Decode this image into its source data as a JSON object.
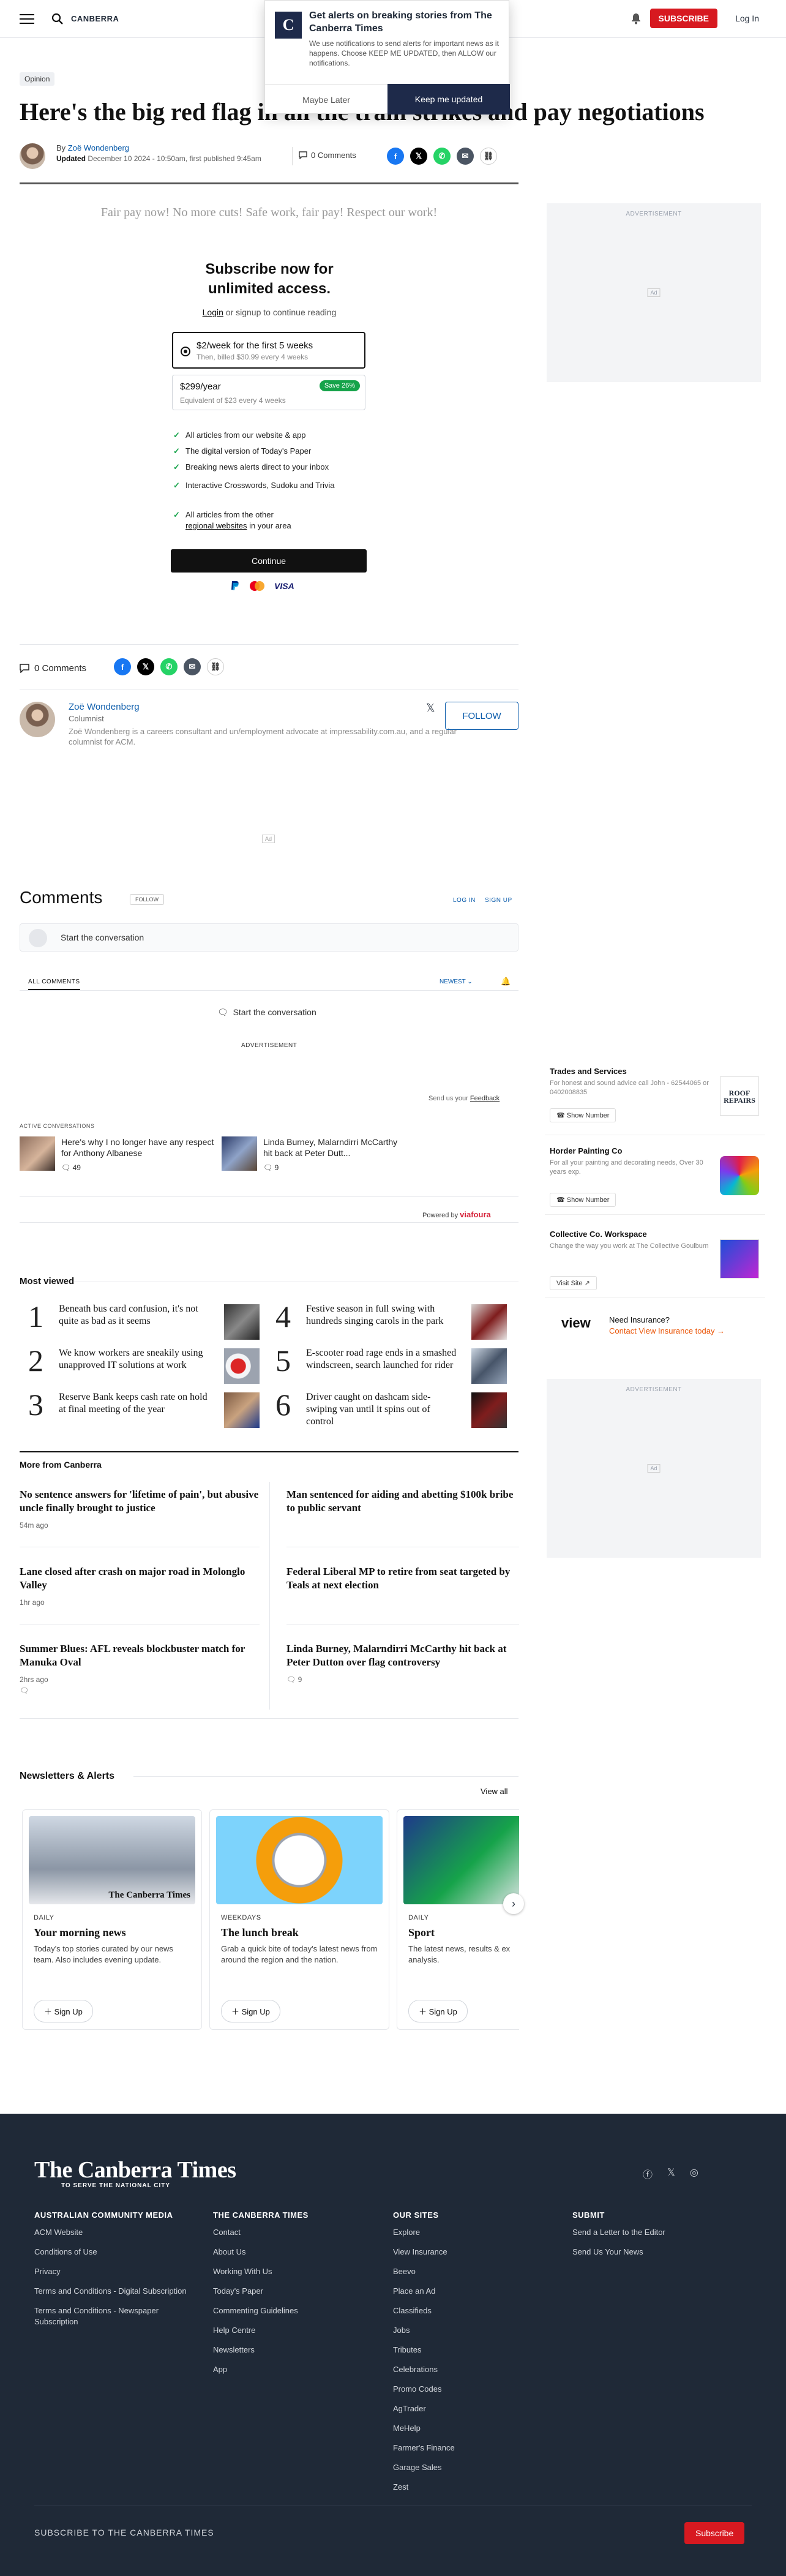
{
  "nav": {
    "brand": "CANBERRA",
    "subscribe": "SUBSCRIBE",
    "login": "Log In"
  },
  "notification": {
    "title": "Get alerts on breaking stories from The Canberra Times",
    "body": "We use notifications to send alerts for important news as it happens. Choose KEEP ME UPDATED, then ALLOW our notifications.",
    "maybe": "Maybe Later",
    "keep": "Keep me updated",
    "logo_letter": "C"
  },
  "article": {
    "tag": "Opinion",
    "headline": "Here's the big red flag in all the train strikes and pay negotiations",
    "by": "By",
    "author": "Zoë Wondenberg",
    "updated_label": "Updated",
    "dates": "December 10 2024 - 10:50am, first published 9:45am",
    "comments": "0 Comments",
    "quote": "Fair pay now! No more cuts! Safe work, fair pay! Respect our work!"
  },
  "paywall": {
    "title": "Subscribe now for unlimited access.",
    "login_link": "Login",
    "login_rest": " or signup to continue reading",
    "plan1_title": "$2/week for the first 5 weeks",
    "plan1_sub": "Then, billed $30.99 every 4 weeks",
    "plan2_title": "$299/year",
    "plan2_sub": "Equivalent of $23 every 4 weeks",
    "plan2_badge": "Save 26%",
    "features": [
      "All articles from our website & app",
      "The digital version of Today's Paper",
      "Breaking news alerts direct to your inbox",
      "Interactive Crosswords, Sudoku and Trivia"
    ],
    "feature_last_a": "All articles from the other",
    "feature_last_link": "regional websites",
    "feature_last_b": " in your area",
    "continue": "Continue",
    "visa": "VISA"
  },
  "ads": {
    "advertisement": "ADVERTISEMENT",
    "ad": "Ad"
  },
  "author_box": {
    "name": "Zoë Wondenberg",
    "role": "Columnist",
    "bio": "Zoë Wondenberg is a careers consultant and un/employment advocate at impressability.com.au, and a regular columnist for ACM.",
    "follow": "FOLLOW",
    "comments": "0 Comments"
  },
  "comments": {
    "title": "Comments",
    "follow": "FOLLOW",
    "login": "LOG IN",
    "signup": "SIGN UP",
    "placeholder": "Start the conversation",
    "all": "ALL COMMENTS",
    "newest": "NEWEST",
    "start": "Start the conversation",
    "feedback_a": "Send us your ",
    "feedback_link": "Feedback",
    "active": "ACTIVE CONVERSATIONS",
    "conversations": [
      {
        "title": "Here's why I no longer have any respect for Anthony Albanese",
        "count": "49"
      },
      {
        "title": "Linda Burney, Malarndirri McCarthy hit back at Peter Dutt...",
        "count": "9"
      }
    ],
    "powered": "Powered by",
    "brand": "viafoura"
  },
  "sponsored": [
    {
      "title": "Trades and Services",
      "desc": "For honest and sound advice call John - 62544065 or 0402008835",
      "button": "Show Number"
    },
    {
      "title": "Horder Painting Co",
      "desc": "For all your painting and decorating needs, Over 30 years exp.",
      "button": "Show Number"
    },
    {
      "title": "Collective Co. Workspace",
      "desc": "Change the way you work at The Collective Goulburn",
      "button": "Visit Site"
    }
  ],
  "insurance": {
    "logo": "view",
    "q": "Need Insurance?",
    "cta": "Contact View Insurance today"
  },
  "most_viewed": {
    "title": "Most viewed",
    "items": [
      {
        "n": "1",
        "t": "Beneath bus card confusion, it's not quite as bad as it seems"
      },
      {
        "n": "2",
        "t": "We know workers are sneakily using unapproved IT solutions at work"
      },
      {
        "n": "3",
        "t": "Reserve Bank keeps cash rate on hold at final meeting of the year"
      },
      {
        "n": "4",
        "t": "Festive season in full swing with hundreds singing carols in the park"
      },
      {
        "n": "5",
        "t": "E-scooter road rage ends in a smashed windscreen, search launched for rider"
      },
      {
        "n": "6",
        "t": "Driver caught on dashcam side-swiping van until it spins out of control"
      }
    ]
  },
  "more": {
    "title": "More from Canberra",
    "left": [
      {
        "t": "No sentence answers for 'lifetime of pain', but abusive uncle finally brought to justice",
        "ago": "54m ago"
      },
      {
        "t": "Lane closed after crash on major road in Molonglo Valley",
        "ago": "1hr ago"
      },
      {
        "t": "Summer Blues: AFL reveals blockbuster match for Manuka Oval",
        "ago": "2hrs ago"
      }
    ],
    "right": [
      {
        "t": "Man sentenced for aiding and abetting $100k bribe to public servant"
      },
      {
        "t": "Federal Liberal MP to retire from seat targeted by Teals at next election"
      },
      {
        "t": "Linda Burney, Malarndirri McCarthy hit back at Peter Dutton over flag controversy",
        "count": "9"
      }
    ]
  },
  "newsletters": {
    "title": "Newsletters & Alerts",
    "view_all": "View all",
    "items": [
      {
        "kicker": "DAILY",
        "title": "Your morning news",
        "desc": "Today's top stories curated by our news team. Also includes evening update.",
        "signup": "Sign Up",
        "img_text": "The Canberra Times"
      },
      {
        "kicker": "WEEKDAYS",
        "title": "The lunch break",
        "desc": "Grab a quick bite of today's latest news from around the region and the nation.",
        "signup": "Sign Up"
      },
      {
        "kicker": "DAILY",
        "title": "Sport",
        "desc": "The latest news, results & ex analysis.",
        "signup": "Sign Up"
      }
    ]
  },
  "footer": {
    "logo": "The Canberra Times",
    "tagline": "TO SERVE THE NATIONAL CITY",
    "cols": [
      {
        "h": "AUSTRALIAN COMMUNITY MEDIA",
        "links": [
          "ACM Website",
          "Conditions of Use",
          "Privacy",
          "Terms and Conditions - Digital Subscription",
          "Terms and Conditions - Newspaper Subscription"
        ]
      },
      {
        "h": "THE CANBERRA TIMES",
        "links": [
          "Contact",
          "About Us",
          "Working With Us",
          "Today's Paper",
          "Commenting Guidelines",
          "Help Centre",
          "Newsletters",
          "App"
        ]
      },
      {
        "h": "OUR SITES",
        "links": [
          "Explore",
          "View Insurance",
          "Beevo",
          "Place an Ad",
          "Classifieds",
          "Jobs",
          "Tributes",
          "Celebrations",
          "Promo Codes",
          "AgTrader",
          "MeHelp",
          "Farmer's Finance",
          "Garage Sales",
          "Zest"
        ]
      },
      {
        "h": "SUBMIT",
        "links": [
          "Send a Letter to the Editor",
          "Send Us Your News"
        ]
      }
    ],
    "subscribe_text": "SUBSCRIBE TO THE CANBERRA TIMES",
    "subscribe_btn": "Subscribe"
  },
  "colors": {
    "brand_red": "#d71920",
    "navy": "#1e2a4a",
    "link": "#0b5cab",
    "footer_bg": "#1f2937"
  }
}
